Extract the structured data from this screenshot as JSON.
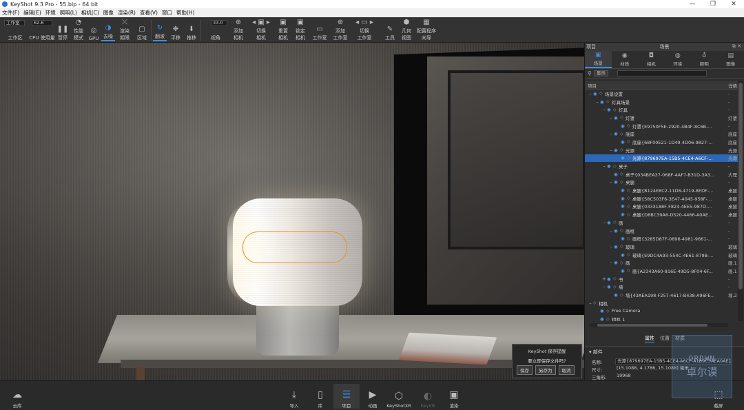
{
  "titlebar": {
    "title": "KeyShot 9.3 Pro  -  55.bip  -  64 bit",
    "minimize": "—",
    "restore": "❐",
    "close": "✕"
  },
  "menu": [
    "文件(F)",
    "编辑(E)",
    "环境",
    "照明(L)",
    "相机(C)",
    "图像",
    "渲染(R)",
    "查看(V)",
    "窗口",
    "帮助(H)"
  ],
  "toolbar": {
    "workspace_value": "工作室",
    "workspace_label": "工作区",
    "cpu_value": "62.6",
    "cpu_label": "CPU 使用量",
    "pause_label": "暂停",
    "perf_label_1": "性能",
    "perf_label_2": "模式",
    "gpu_label": "GPU",
    "denoise_label": "去噪",
    "render_label_1": "渲染",
    "render_label_2": "期限",
    "region_label": "区域",
    "flip_label": "翻滚",
    "pan_label": "平移",
    "dolly_label": "推移",
    "fov_value": "33.0",
    "fov_label": "视角",
    "add_camera_1": "添加",
    "add_camera_2": "相机",
    "switch_camera_1": "切换",
    "switch_camera_2": "相机",
    "reset_camera_1": "重置",
    "reset_camera_2": "相机",
    "lock_camera_1": "锁定",
    "lock_camera_2": "相机",
    "studio_label": "工作室",
    "add_studio_1": "添加",
    "add_studio_2": "工作室",
    "switch_studio_1": "切换",
    "switch_studio_2": "工作室",
    "tools_label": "工具",
    "geometry_view_1": "几何",
    "geometry_view_2": "视图",
    "config_1": "配置程序",
    "config_2": "向导"
  },
  "dialog": {
    "title": "KeyShot 保存提醒",
    "message": "要立即保存文件吗?",
    "save": "保存",
    "save_as": "另存为",
    "cancel": "取消"
  },
  "panel": {
    "header_left": "项目",
    "header_title": "场景",
    "tabs": [
      {
        "label": "场景",
        "icon": "cube-icon",
        "glyph": "▣"
      },
      {
        "label": "材质",
        "icon": "material-icon",
        "glyph": "◉"
      },
      {
        "label": "相机",
        "icon": "camera-icon",
        "glyph": "◘"
      },
      {
        "label": "环境",
        "icon": "environment-icon",
        "glyph": "◍"
      },
      {
        "label": "照明",
        "icon": "light-icon",
        "glyph": "♁"
      },
      {
        "label": "图像",
        "icon": "image-icon",
        "glyph": "▤"
      }
    ],
    "filter_label": "显示",
    "search_placeholder": "",
    "tree_header": {
      "col1": "项目",
      "col2": "详情"
    },
    "tree": [
      {
        "indent": 0,
        "exp": "–",
        "label": "场景设置",
        "col2": "-",
        "sel": false
      },
      {
        "indent": 1,
        "exp": "–",
        "label": "灯具场景",
        "col2": "-",
        "sel": false
      },
      {
        "indent": 2,
        "exp": "–",
        "label": "灯具",
        "col2": "-",
        "sel": false
      },
      {
        "indent": 3,
        "exp": "–",
        "label": "灯罩",
        "col2": "灯罩",
        "sel": false
      },
      {
        "indent": 4,
        "exp": "",
        "label": "灯罩{E9750F5E-2920-4B4F-8C6B-...",
        "col2": "-",
        "sel": false
      },
      {
        "indent": 3,
        "exp": "–",
        "label": "底座",
        "col2": "底座",
        "sel": false
      },
      {
        "indent": 4,
        "exp": "",
        "label": "底座{68F00E21-1D49-4D06-9827-...",
        "col2": "底座",
        "sel": false
      },
      {
        "indent": 3,
        "exp": "–",
        "label": "光源",
        "col2": "光源",
        "sel": false
      },
      {
        "indent": 4,
        "exp": "",
        "label": "光源{879697EA-15B5-4CE4-A6CF-...",
        "col2": "光源",
        "sel": true
      },
      {
        "indent": 2,
        "exp": "–",
        "label": "桌子",
        "col2": "-",
        "sel": false
      },
      {
        "indent": 3,
        "exp": "",
        "label": "桌子{034BEA37-068F-4AF7-B31D-3A3...",
        "col2": "大理",
        "sel": false
      },
      {
        "indent": 3,
        "exp": "–",
        "label": "桌腿",
        "col2": "-",
        "sel": false
      },
      {
        "indent": 4,
        "exp": "",
        "label": "桌腿{B124E8C2-11D8-4719-8EDF-...",
        "col2": "桌腿",
        "sel": false
      },
      {
        "indent": 4,
        "exp": "",
        "label": "桌腿{58C503F6-3E47-4045-958F-...",
        "col2": "桌腿",
        "sel": false
      },
      {
        "indent": 4,
        "exp": "",
        "label": "桌腿{0333188F-F824-4EE5-987D-...",
        "col2": "桌腿",
        "sel": false
      },
      {
        "indent": 4,
        "exp": "",
        "label": "桌腿{D8BC39A6-D520-4466-A0AE...",
        "col2": "桌腿",
        "sel": false
      },
      {
        "indent": 2,
        "exp": "–",
        "label": "画",
        "col2": "-",
        "sel": false
      },
      {
        "indent": 3,
        "exp": "–",
        "label": "画框",
        "col2": "-",
        "sel": false
      },
      {
        "indent": 4,
        "exp": "",
        "label": "画框{3285D87F-0896-4981-9661-...",
        "col2": "-",
        "sel": false
      },
      {
        "indent": 3,
        "exp": "–",
        "label": "玻璃",
        "col2": "玻璃",
        "sel": false
      },
      {
        "indent": 4,
        "exp": "",
        "label": "玻璃{E9DC4A93-554C-4E61-879B-...",
        "col2": "玻璃",
        "sel": false
      },
      {
        "indent": 3,
        "exp": "–",
        "label": "画",
        "col2": "画.1",
        "sel": false
      },
      {
        "indent": 4,
        "exp": "",
        "label": "画{A2343A60-816E-49D5-8F04-6F...",
        "col2": "画.1",
        "sel": false
      },
      {
        "indent": 2,
        "exp": "+",
        "label": "书",
        "col2": "-",
        "sel": false
      },
      {
        "indent": 2,
        "exp": "–",
        "label": "墙",
        "col2": "-",
        "sel": false
      },
      {
        "indent": 3,
        "exp": "",
        "label": "墙{43AEA198-F257-4617-B438-A96FE...",
        "col2": "墙.2",
        "sel": false
      },
      {
        "indent": 0,
        "exp": "–",
        "label": "相机",
        "col2": "",
        "sel": false
      },
      {
        "indent": 1,
        "exp": "",
        "label": "Free Camera",
        "col2": "",
        "sel": false
      },
      {
        "indent": 1,
        "exp": "",
        "label": "相机 1",
        "col2": "",
        "sel": false
      }
    ],
    "sub_tabs": [
      "属性",
      "位置",
      "材质"
    ],
    "props_section": "部件",
    "props": [
      {
        "key": "名称:",
        "value": "光源{879697EA-15B5-4CE4-A6CF-A1B9C3AEA0AE}"
      },
      {
        "key": "尺寸:",
        "value": "[15.1088, 4.1786, 15.1088] 毫米"
      },
      {
        "key": "三角形:",
        "value": "19968"
      }
    ]
  },
  "bottombar": {
    "items": [
      {
        "label": "云库",
        "icon": "cloud-icon",
        "glyph": "☁",
        "state": "normal"
      },
      {
        "label": "导入",
        "icon": "import-icon",
        "glyph": "⤓",
        "state": "normal"
      },
      {
        "label": "库",
        "icon": "library-icon",
        "glyph": "▯",
        "state": "normal"
      },
      {
        "label": "项目",
        "icon": "project-icon",
        "glyph": "☰",
        "state": "active"
      },
      {
        "label": "动画",
        "icon": "animation-icon",
        "glyph": "▶",
        "state": "normal"
      },
      {
        "label": "KeyShotXR",
        "icon": "keyshotxr-icon",
        "glyph": "⬡",
        "state": "normal"
      },
      {
        "label": "KeyVR",
        "icon": "keyvr-icon",
        "glyph": "◐",
        "state": "dim"
      },
      {
        "label": "渲染",
        "icon": "render-icon",
        "glyph": "▣",
        "state": "normal"
      },
      {
        "label": "截屏",
        "icon": "screenshot-icon",
        "glyph": "⬚",
        "state": "normal"
      }
    ]
  },
  "watermark": {
    "line1": "DRDWN",
    "line2": "卓尔谟"
  },
  "colors": {
    "accent": "#3a8ee6",
    "selection_outline": "#f08a24",
    "selected_row": "#2d67b5"
  }
}
